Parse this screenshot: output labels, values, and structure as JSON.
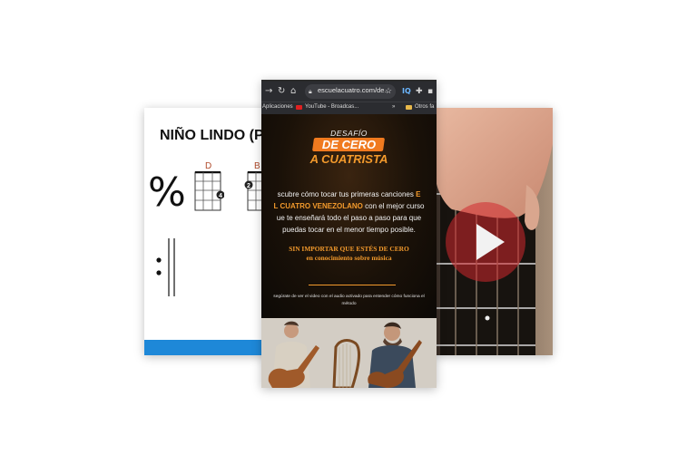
{
  "sheet": {
    "title": "NIÑO LINDO (Pag",
    "repeat_sign": "%",
    "chords": [
      {
        "name": "D",
        "finger": "4"
      },
      {
        "name": "B",
        "finger": "2"
      }
    ]
  },
  "browser": {
    "url": "escuelacuatro.com/de...",
    "bookmarks": {
      "apps": "Aplicaciones",
      "youtube": "YouTube - Broadcas...",
      "more": "»",
      "others": "Otros fa"
    },
    "icons": [
      "forward-icon",
      "reload-icon",
      "home-icon",
      "lock-icon",
      "star-icon",
      "extension-icon"
    ],
    "extension_label": "IQ"
  },
  "landing": {
    "kicker": "DESAFÍO",
    "headline_1": "DE CERO",
    "headline_2": "A CUATRISTA",
    "desc_line1_a": "scubre cómo tocar tus primeras canciones ",
    "desc_line1_b": "E",
    "desc_line2_a": "L CUATRO VENEZOLANO",
    "desc_line2_b": " con el mejor curso",
    "desc_line3": "ue te enseñará todo el paso a paso para que",
    "desc_line4": "puedas tocar en el menor tiempo posible.",
    "subhead_1": "SIN IMPORTAR QUE ESTÉS DE CERO",
    "subhead_2": "en conocimiento sobre música",
    "note_1": "segúrate de ver el video con el audio activado para entender cómo funciona el",
    "note_2": "método"
  },
  "colors": {
    "accent_orange": "#f39a2c",
    "badge_orange": "#f07a1f",
    "sheet_bar_blue": "#1e88d8",
    "play_red": "#d8383a"
  }
}
